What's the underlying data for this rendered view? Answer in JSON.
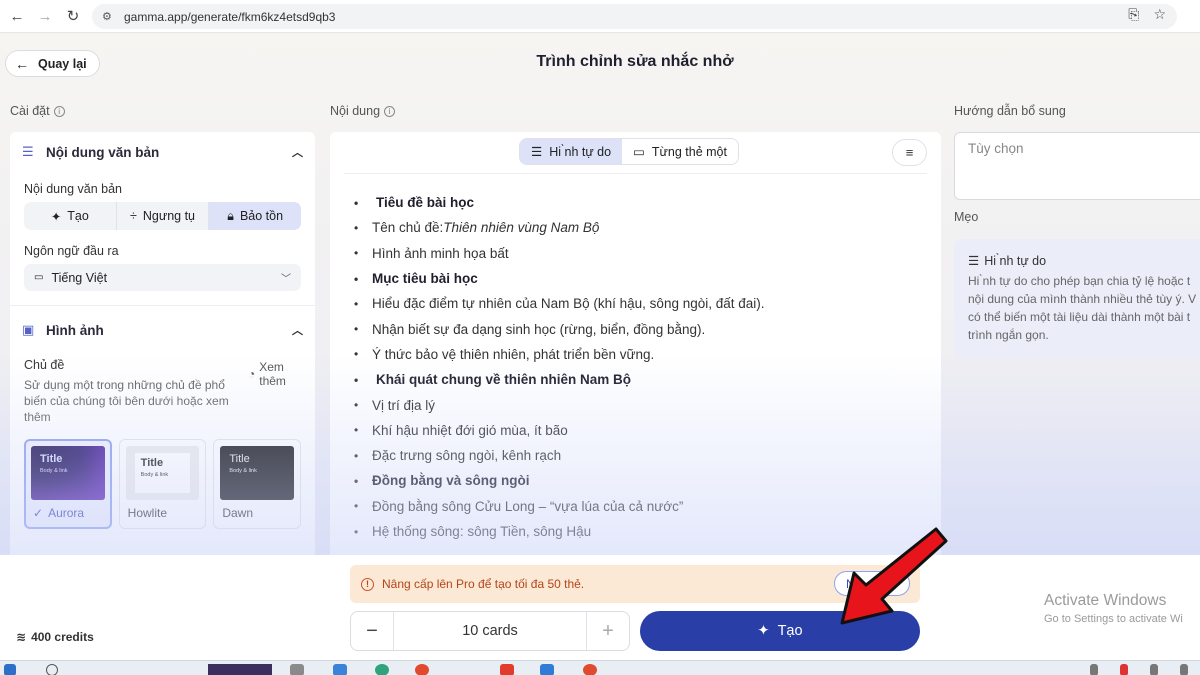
{
  "browser": {
    "url": "gamma.app/generate/fkm6kz4etsd9qb3"
  },
  "header": {
    "back_label": "Quay lại",
    "title": "Trình chỉnh sửa nhắc nhở"
  },
  "sections": {
    "settings": "Cài đặt",
    "content": "Nội dung",
    "extra": "Hướng dẫn bổ sung",
    "tips": "Mẹo"
  },
  "text_settings": {
    "group_title": "Nội dung văn bản",
    "field_label": "Nội dung văn bản",
    "options": [
      "Tạo",
      "Ngưng tụ",
      "Bảo tồn"
    ],
    "selected": "Bảo tồn",
    "language_label": "Ngôn ngữ đầu ra",
    "language_value": "Tiếng Việt"
  },
  "image_settings": {
    "group_title": "Hình ảnh",
    "theme_label": "Chủ đề",
    "theme_desc": "Sử dụng một trong những chủ đề phổ biến của chúng tôi bên dưới hoặc xem thêm",
    "see_more": "Xem thêm",
    "themes": [
      {
        "name": "Aurora",
        "title": "Title",
        "body": "Body & link",
        "selected": true
      },
      {
        "name": "Howlite",
        "title": "Title",
        "body": "Body & link",
        "selected": false
      },
      {
        "name": "Dawn",
        "title": "Title",
        "body": "Body & link",
        "selected": false
      }
    ]
  },
  "content_panel": {
    "modes": [
      "Hi ̀nh tự do",
      "Từng thẻ một"
    ],
    "active_mode": "Hi ̀nh tự do",
    "outline": [
      {
        "text": "Tiêu đề bài học",
        "bold": true
      },
      {
        "text_prefix": "Tên chủ đề: ",
        "text_italic": "Thiên nhiên vùng Nam Bộ",
        "bold": false
      },
      {
        "text": "Hình ảnh minh họa bất",
        "bold": false
      },
      {
        "text": "Mục tiêu bài học",
        "bold": true
      },
      {
        "text": "Hiểu đặc điểm tự nhiên của Nam Bộ (khí hậu, sông ngòi, đất đai).",
        "bold": false
      },
      {
        "text": "Nhận biết sự đa dạng sinh học (rừng, biển, đồng bằng).",
        "bold": false
      },
      {
        "text": "Ý thức bảo vệ thiên nhiên, phát triển bền vững.",
        "bold": false
      },
      {
        "text": "Khái quát chung về thiên nhiên Nam Bộ",
        "bold": true
      },
      {
        "text": "Vị trí địa lý",
        "bold": false
      },
      {
        "text": "Khí hậu nhiệt đới gió mùa, ít bão",
        "bold": false
      },
      {
        "text": "Đặc trưng sông ngòi, kênh rạch",
        "bold": false
      },
      {
        "text": "Đồng bằng và sông ngòi",
        "bold": true
      },
      {
        "text": "Đồng bằng sông Cửu Long – “vựa lúa của cả nước”",
        "bold": false
      },
      {
        "text": "Hệ thống sông: sông Tiền, sông Hậu",
        "bold": false
      }
    ]
  },
  "extra_panel": {
    "placeholder": "Tùy chọn"
  },
  "tip": {
    "title": "Hi ̀nh tự  do",
    "body": "Hi ̀nh tự  do cho phép bạn chia tỷ lệ hoặc t nội dung của mình thành nhiều thẻ tùy ý. V có thể biến một tài liệu dài thành một bài t trình ngắn gọn."
  },
  "footer": {
    "banner": "Nâng cấp lên Pro để tạo tối đa 50 thẻ.",
    "banner_pill": "N",
    "card_count": "10 cards",
    "generate_label": "Tạo",
    "credits": "400 credits"
  },
  "watermark": {
    "line1": "Activate Windows",
    "line2": "Go to Settings to activate Wi"
  },
  "colors": {
    "primary": "#2a3ea8",
    "selected_bg": "#dde2f8",
    "banner_bg": "#fbe8d5",
    "banner_text": "#b5451a",
    "arrow": "#e8141b"
  }
}
